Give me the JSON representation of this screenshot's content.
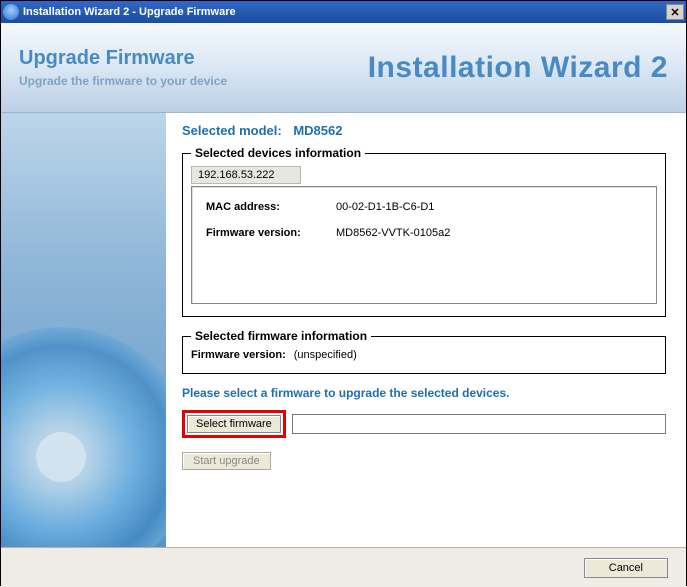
{
  "window": {
    "title": "Installation Wizard 2 - Upgrade Firmware",
    "app_icon_glyph": "⊕"
  },
  "header": {
    "title": "Upgrade Firmware",
    "subtitle": "Upgrade the firmware to your device",
    "app_name": "Installation Wizard 2"
  },
  "content": {
    "selected_model_label": "Selected model:",
    "selected_model_value": "MD8562",
    "devices_group_legend": "Selected devices information",
    "ip_address": "192.168.53.222",
    "mac_label": "MAC address:",
    "mac_value": "00-02-D1-1B-C6-D1",
    "fw_label": "Firmware version:",
    "fw_value": "MD8562-VVTK-0105a2",
    "firmware_group_legend": "Selected firmware information",
    "sel_fw_label": "Firmware version:",
    "sel_fw_value": "(unspecified)",
    "instruction": "Please select a firmware to upgrade the selected devices.",
    "select_button": "Select firmware",
    "path_value": "",
    "path_placeholder": "",
    "start_button": "Start upgrade"
  },
  "footer": {
    "cancel": "Cancel"
  }
}
